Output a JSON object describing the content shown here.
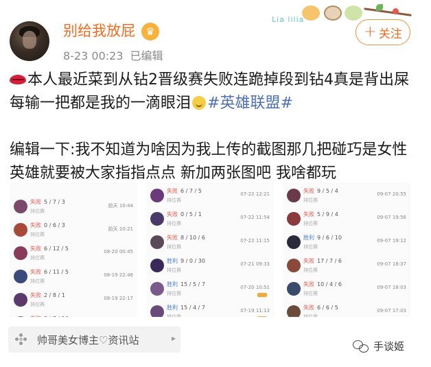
{
  "post": {
    "username": "别给我放屁",
    "time": "8-23 00:23",
    "edited": "已编辑",
    "follow_label": "关注",
    "decor_text": "Lia lilia",
    "content_line1_a": "本人最近菜到从钻2晋级赛失败连跪掉段到钻4真是背出屎 每输一把都是我的一滴眼泪",
    "hashtag": "#英雄联盟#",
    "content_line2": "编辑一下:我不知道为啥因为我上传的截图那几把碰巧是女性英雄就要被大家指指点点 新加两张图吧 我啥都玩"
  },
  "screenshots": [
    {
      "rows": [
        {
          "result": "失败",
          "kda": "5 / 7 / 3",
          "mode": "排位赛",
          "time": "前天 10:44",
          "color": "#7a4a6a",
          "outcome": "lose"
        },
        {
          "result": "失败",
          "kda": "0 / 6 / 3",
          "mode": "排位赛",
          "time": "前天 10:21",
          "color": "#a84a3a",
          "outcome": "lose"
        },
        {
          "result": "失败",
          "kda": "6 / 12 / 5",
          "mode": "排位赛",
          "time": "08-20 00:45",
          "color": "#8a3a5a",
          "outcome": "lose"
        },
        {
          "result": "失败",
          "kda": "6 / 11 / 5",
          "mode": "排位赛",
          "time": "08-19 22:46",
          "color": "#3a4a7a",
          "outcome": "lose"
        },
        {
          "result": "失败",
          "kda": "2 / 8 / 1",
          "mode": "排位赛",
          "time": "08-19 22:17",
          "color": "#5a3a6a",
          "outcome": "lose"
        },
        {
          "result": "失败",
          "kda": "5 / 7 / 10",
          "mode": "排位赛",
          "time": "",
          "color": "#6a4a5a",
          "outcome": "lose"
        }
      ]
    },
    {
      "rows": [
        {
          "result": "失败",
          "kda": "6 / 7 / 5",
          "mode": "排位赛",
          "time": "07-22 12:21",
          "color": "#6a3a7a",
          "outcome": "lose"
        },
        {
          "result": "失败",
          "kda": "0 / 5 / 1",
          "mode": "排位赛",
          "time": "07-22 11:54",
          "color": "#4a3a6a",
          "outcome": "lose"
        },
        {
          "result": "失败",
          "kda": "8 / 10 / 6",
          "mode": "排位赛",
          "time": "07-22 11:15",
          "color": "#5a4a5a",
          "outcome": "lose"
        },
        {
          "result": "胜利",
          "kda": "9 / 0 / 30",
          "mode": "排位赛",
          "time": "07-21 09:33",
          "color": "#3a2a5a",
          "outcome": "win"
        },
        {
          "result": "胜利",
          "kda": "15 / 5 / 7",
          "mode": "排位赛",
          "time": "07-20 10:51",
          "color": "#7a5a8a",
          "outcome": "win"
        },
        {
          "result": "胜利",
          "kda": "15 / 4 / 7",
          "mode": "排位赛",
          "time": "07-19 11:13",
          "color": "#6a4a7a",
          "outcome": "win"
        }
      ]
    },
    {
      "rows": [
        {
          "result": "失败",
          "kda": "9 / 5 / 4",
          "mode": "排位赛",
          "time": "09-07 20:55",
          "color": "#6a3a4a",
          "outcome": "lose"
        },
        {
          "result": "失败",
          "kda": "5 / 9 / 4",
          "mode": "排位赛",
          "time": "09-07 19:56",
          "color": "#8a3a3a",
          "outcome": "lose"
        },
        {
          "result": "胜利",
          "kda": "9 / 6 / 10",
          "mode": "排位赛",
          "time": "09-07 19:12",
          "color": "#2a2a3a",
          "outcome": "win"
        },
        {
          "result": "失败",
          "kda": "17 / 7 / 6",
          "mode": "排位赛",
          "time": "09-07 18:37",
          "color": "#8a4a3a",
          "outcome": "lose"
        },
        {
          "result": "失败",
          "kda": "10 / 4 / 6",
          "mode": "排位赛",
          "time": "09-07 18:03",
          "color": "#3a4a6a",
          "outcome": "lose"
        },
        {
          "result": "失败",
          "kda": "6 / 6 / 5",
          "mode": "排位赛",
          "time": "09-07 17:03",
          "color": "#6a4a3a",
          "outcome": "lose"
        }
      ]
    }
  ],
  "source": {
    "label": "帅哥美女博主♡资讯站",
    "arrow": "▸"
  },
  "watermark": {
    "text": "手谈姬"
  },
  "colors": {
    "username": "#f26b21",
    "hashtag": "#4c6fb5",
    "follow_border": "#f5923e",
    "lose": "#e2574c",
    "win": "#4c7fd6"
  }
}
